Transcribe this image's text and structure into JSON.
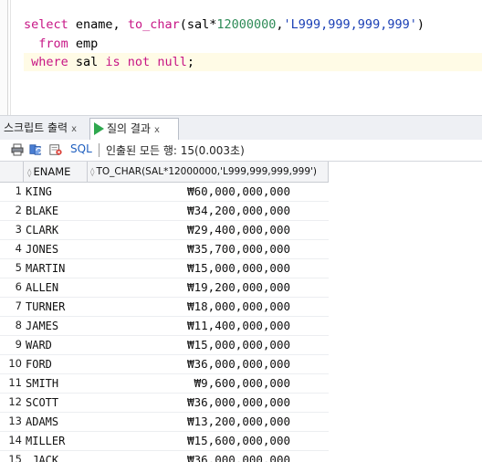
{
  "editor": {
    "lines": [
      {
        "kw": "select",
        "plain1": " ename, ",
        "fn": "to_char",
        "plain2": "(sal*",
        "num": "12000000",
        "plain3": ",",
        "str": "'L999,999,999,999'",
        "plain4": ")"
      },
      {
        "indent": "  ",
        "kw": "from",
        "rest": " emp"
      },
      {
        "indent": " ",
        "kw1": "where",
        "mid1": " sal ",
        "kw2": "is not null",
        "rest": ";"
      }
    ]
  },
  "tabs": [
    {
      "label": "스크립트 출력",
      "close": "x"
    },
    {
      "label": "질의 결과",
      "close": "x"
    }
  ],
  "toolbar": {
    "sql_label": "SQL",
    "status": "인출된 모든 행: 15(0.003초)"
  },
  "grid": {
    "columns": [
      "ENAME",
      "TO_CHAR(SAL*12000000,'L999,999,999,999')"
    ],
    "rows": [
      {
        "n": "1",
        "ename": "KING",
        "value": "₩60,000,000,000"
      },
      {
        "n": "2",
        "ename": "BLAKE",
        "value": "₩34,200,000,000"
      },
      {
        "n": "3",
        "ename": "CLARK",
        "value": "₩29,400,000,000"
      },
      {
        "n": "4",
        "ename": "JONES",
        "value": "₩35,700,000,000"
      },
      {
        "n": "5",
        "ename": "MARTIN",
        "value": "₩15,000,000,000"
      },
      {
        "n": "6",
        "ename": "ALLEN",
        "value": "₩19,200,000,000"
      },
      {
        "n": "7",
        "ename": "TURNER",
        "value": "₩18,000,000,000"
      },
      {
        "n": "8",
        "ename": "JAMES",
        "value": "₩11,400,000,000"
      },
      {
        "n": "9",
        "ename": "WARD",
        "value": "₩15,000,000,000"
      },
      {
        "n": "10",
        "ename": "FORD",
        "value": "₩36,000,000,000"
      },
      {
        "n": "11",
        "ename": "SMITH",
        "value": "₩9,600,000,000"
      },
      {
        "n": "12",
        "ename": "SCOTT",
        "value": "₩36,000,000,000"
      },
      {
        "n": "13",
        "ename": "ADAMS",
        "value": "₩13,200,000,000"
      },
      {
        "n": "14",
        "ename": "MILLER",
        "value": "₩15,600,000,000"
      },
      {
        "n": "15",
        "ename": " JACK",
        "value": "₩36,000,000,000"
      }
    ]
  },
  "colors": {
    "keyword": "#c71585",
    "number": "#2e8b57",
    "string": "#1a3fb5",
    "run_icon": "#2fa84f"
  }
}
